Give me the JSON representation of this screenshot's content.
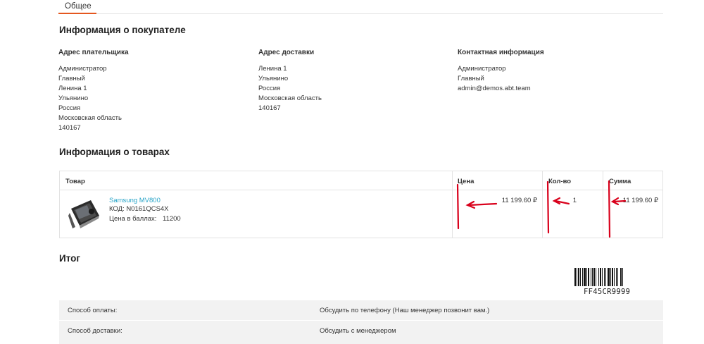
{
  "tabs": [
    {
      "label": "Общее",
      "active": true
    }
  ],
  "buyer_section": {
    "title": "Информация о покупателе",
    "billing": {
      "title": "Адрес плательщика",
      "lines": [
        "Администратор",
        "Главный",
        "Ленина 1",
        "Ульянино",
        "Россия",
        "Московская область",
        "140167"
      ]
    },
    "shipping": {
      "title": "Адрес доставки",
      "lines": [
        "Ленина 1",
        "Ульянино",
        "Россия",
        "Московская область",
        "140167"
      ]
    },
    "contact": {
      "title": "Контактная информация",
      "lines": [
        "Администратор",
        "Главный",
        "admin@demos.abt.team"
      ]
    }
  },
  "products_section": {
    "title": "Информация о товарах",
    "columns": {
      "product": "Товар",
      "price": "Цена",
      "qty": "Кол-во",
      "sum": "Сумма"
    },
    "items": [
      {
        "name": "Samsung MV800",
        "code": "КОД: N0161QCS4X",
        "points_label": "Цена в баллах:",
        "points_value": "11200",
        "price": "11 199.60 ₽",
        "qty": "1",
        "sum": "11 199.60 ₽"
      }
    ]
  },
  "total_section": {
    "title": "Итог",
    "barcode_text": "FF45CR9999",
    "rows": [
      {
        "label": "Способ оплаты:",
        "value": "Обсудить по телефону (Наш менеджер позвонит вам.)"
      },
      {
        "label": "Способ доставки:",
        "value": "Обсудить с менеджером"
      }
    ]
  },
  "colors": {
    "accent": "#e4571f",
    "link": "#26a3c7",
    "annotation": "#d9001b",
    "summary_bg": "#f2f2f2"
  }
}
